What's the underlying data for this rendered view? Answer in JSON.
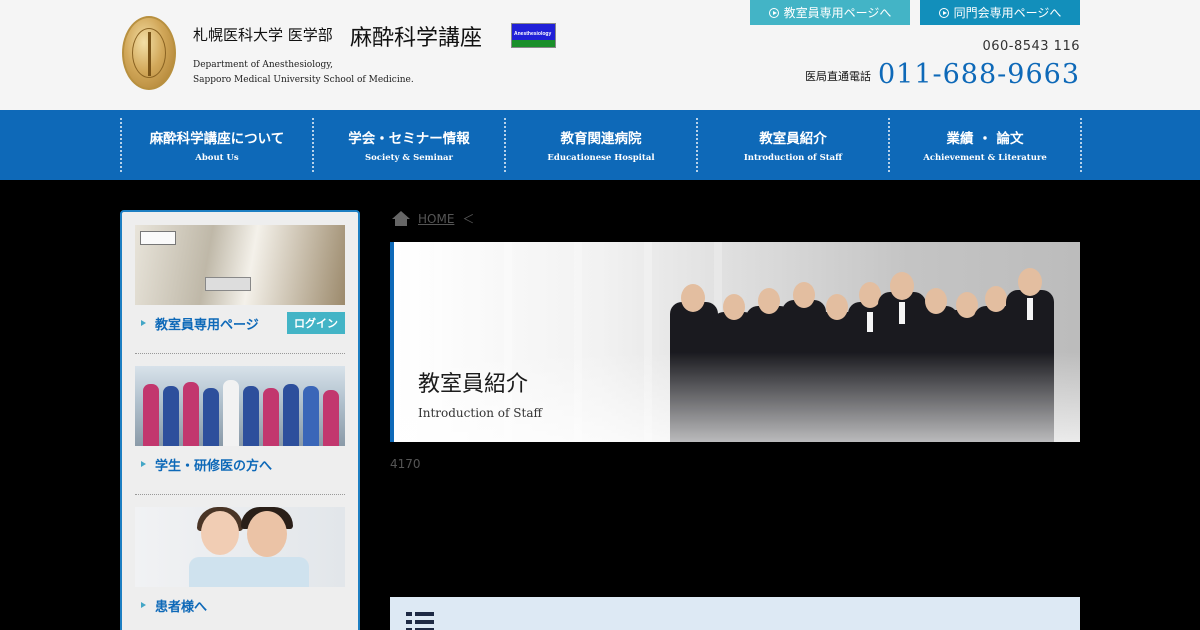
{
  "header": {
    "university": "札幌医科大学 医学部",
    "department": "麻酔科学講座",
    "department_en_line1": "Department of Anesthesiology,",
    "department_en_line2": "Sapporo Medical University School of Medicine.",
    "journal_badge": "Anesthesiology",
    "staff_page_button": "教室員専用ページへ",
    "alumni_page_button": "同門会専用ページへ",
    "postal_code": "060-8543 116",
    "direct_tel_label": "医局直通電話",
    "direct_tel": "011-688-9663"
  },
  "nav": {
    "items": [
      {
        "jp": "麻酔科学講座について",
        "en": "About Us"
      },
      {
        "jp": "学会・セミナー情報",
        "en": "Society & Seminar"
      },
      {
        "jp": "教育関連病院",
        "en": "Educationese Hospital"
      },
      {
        "jp": "教室員紹介",
        "en": "Introduction of Staff"
      },
      {
        "jp": "業績 ・ 論文",
        "en": "Achievement & Literature"
      }
    ]
  },
  "sidebar": {
    "staff_link": "教室員専用ページ",
    "login_button": "ログイン",
    "students_link": "学生・研修医の方へ",
    "patients_link": "患者様へ"
  },
  "breadcrumb": {
    "home": "HOME",
    "separator": "＜"
  },
  "hero": {
    "title": "教室員紹介",
    "subtitle": "Introduction of Staff"
  },
  "page_id": "4170",
  "colors": {
    "brand_blue": "#0e69b8",
    "accent_teal": "#43b4c6",
    "accent_dark_teal": "#128fbb"
  },
  "icons": [
    "home-icon",
    "list-icon",
    "play-circle-icon",
    "arrow-right-icon"
  ]
}
